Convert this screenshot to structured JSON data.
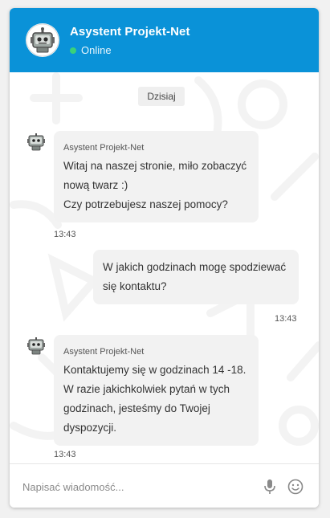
{
  "header": {
    "title": "Asystent Projekt-Net",
    "status": "Online",
    "status_color": "#3ad17a",
    "brand_color": "#0a92d8"
  },
  "chat": {
    "day_label": "Dzisiaj",
    "messages": [
      {
        "from": "bot",
        "sender": "Asystent Projekt-Net",
        "lines": [
          "Witaj na naszej stronie, miło zobaczyć",
          "nową twarz :)",
          "Czy potrzebujesz naszej pomocy?"
        ],
        "time": "13:43"
      },
      {
        "from": "user",
        "lines": [
          "W jakich godzinach mogę spodziewać",
          "się kontaktu?"
        ],
        "time": "13:43"
      },
      {
        "from": "bot",
        "sender": "Asystent Projekt-Net",
        "lines": [
          "Kontaktujemy się w godzinach 14 -18.",
          "W razie jakichkolwiek pytań w tych",
          "godzinach, jesteśmy do Twojej",
          "dyspozycji."
        ],
        "time": "13:43"
      }
    ]
  },
  "composer": {
    "placeholder": "Napisać wiadomość...",
    "mic_icon": "microphone-icon",
    "emoji_icon": "emoji-icon"
  }
}
